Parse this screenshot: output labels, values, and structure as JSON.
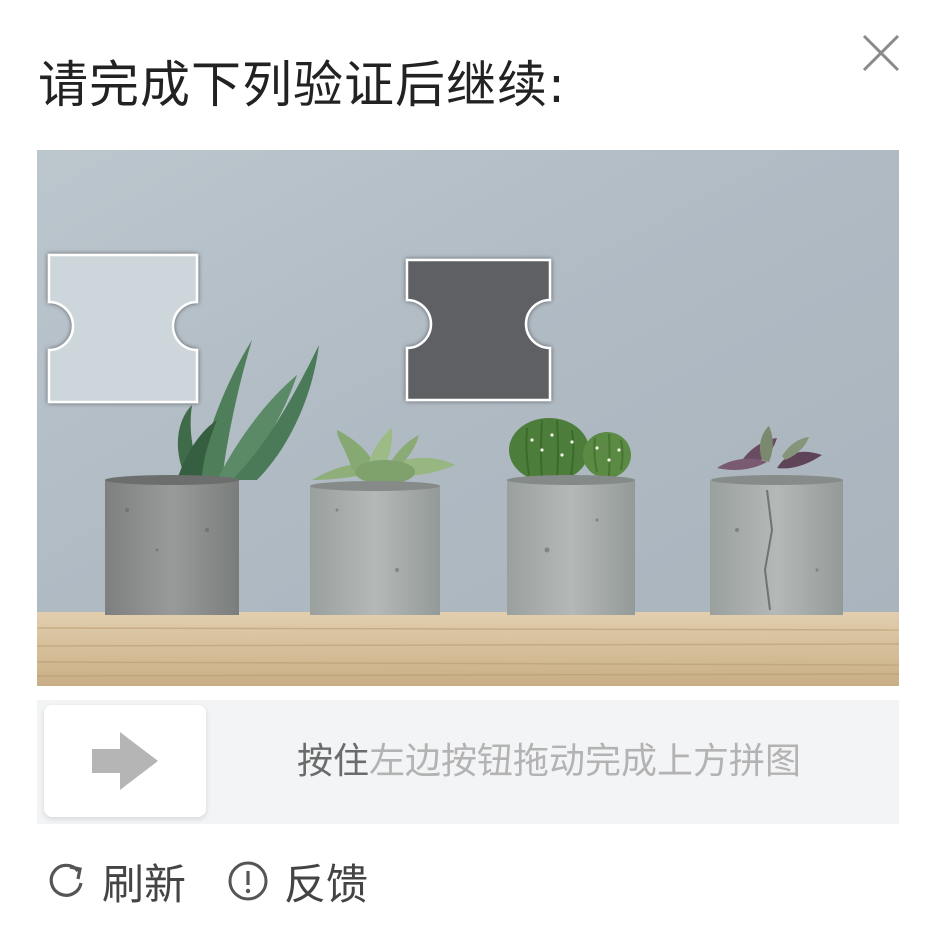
{
  "dialog": {
    "title": "请完成下列验证后继续:",
    "close_icon": "close-icon"
  },
  "puzzle": {
    "image_subject": "four potted succulents on a wooden shelf",
    "piece_icon": "puzzle-piece",
    "target_icon": "puzzle-slot"
  },
  "slider": {
    "handle_icon": "arrow-right-icon",
    "hint_prefix": "按住",
    "hint_rest": "左边按钮拖动完成上方拼图"
  },
  "footer": {
    "refresh_icon": "refresh-icon",
    "refresh_label": "刷新",
    "feedback_icon": "info-circle-icon",
    "feedback_label": "反馈"
  },
  "colors": {
    "wall": "#b4bec6",
    "shelf": "#d8c3a0",
    "slot": "#5f6163",
    "slider_bg": "#f3f4f6",
    "hint_text": "#b3b3b3"
  }
}
